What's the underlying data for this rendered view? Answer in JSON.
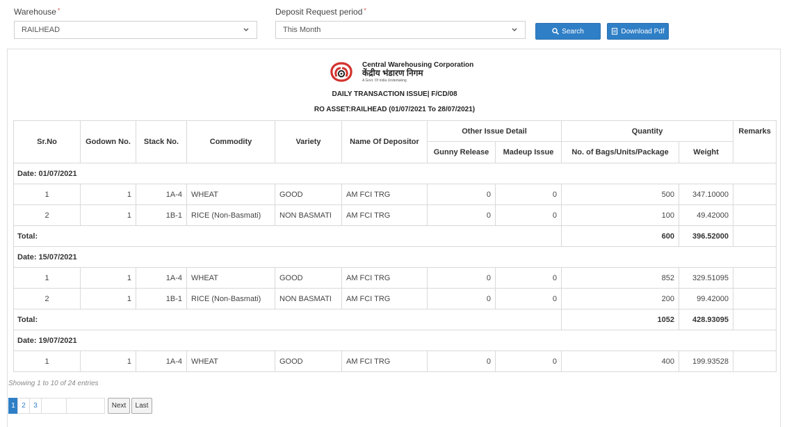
{
  "filters": {
    "warehouse_label": "Warehouse",
    "warehouse_value": "RAILHEAD",
    "period_label": "Deposit Request period",
    "period_value": "This Month",
    "required_mark": "*",
    "search_label": "Search",
    "download_label": "Download Pdf"
  },
  "header": {
    "org_name": "Central Warehousing Corporation",
    "org_hindi": "केंद्रीय भंडारण निगम",
    "org_sub": "A Govt. Of India Undertaking",
    "report_title": "DAILY TRANSACTION ISSUE| F/CD/08",
    "report_subtitle": "RO ASSET:RAILHEAD (01/07/2021 To 28/07/2021)"
  },
  "columns": {
    "srno": "Sr.No",
    "godown": "Godown No.",
    "stack": "Stack No.",
    "commodity": "Commodity",
    "variety": "Variety",
    "depositor": "Name Of Depositor",
    "other_issue": "Other Issue Detail",
    "gunny": "Gunny Release",
    "madeup": "Madeup Issue",
    "quantity": "Quantity",
    "bags": "No. of Bags/Units/Package",
    "weight": "Weight",
    "remarks": "Remarks"
  },
  "groups": [
    {
      "date_label": "Date: 01/07/2021",
      "rows": [
        {
          "sr": "1",
          "godown": "1",
          "stack": "1A-4",
          "commodity": "WHEAT",
          "variety": "GOOD",
          "depositor": "AM FCI TRG",
          "gunny": "0",
          "madeup": "0",
          "bags": "500",
          "weight": "347.10000",
          "remarks": ""
        },
        {
          "sr": "2",
          "godown": "1",
          "stack": "1B-1",
          "commodity": "RICE (Non-Basmati)",
          "variety": "NON BASMATI",
          "depositor": "AM FCI TRG",
          "gunny": "0",
          "madeup": "0",
          "bags": "100",
          "weight": "49.42000",
          "remarks": ""
        }
      ],
      "total_label": "Total:",
      "total_bags": "600",
      "total_weight": "396.52000"
    },
    {
      "date_label": "Date: 15/07/2021",
      "rows": [
        {
          "sr": "1",
          "godown": "1",
          "stack": "1A-4",
          "commodity": "WHEAT",
          "variety": "GOOD",
          "depositor": "AM FCI TRG",
          "gunny": "0",
          "madeup": "0",
          "bags": "852",
          "weight": "329.51095",
          "remarks": ""
        },
        {
          "sr": "2",
          "godown": "1",
          "stack": "1B-1",
          "commodity": "RICE (Non-Basmati)",
          "variety": "NON BASMATI",
          "depositor": "AM FCI TRG",
          "gunny": "0",
          "madeup": "0",
          "bags": "200",
          "weight": "99.42000",
          "remarks": ""
        }
      ],
      "total_label": "Total:",
      "total_bags": "1052",
      "total_weight": "428.93095"
    },
    {
      "date_label": "Date: 19/07/2021",
      "rows": [
        {
          "sr": "1",
          "godown": "1",
          "stack": "1A-4",
          "commodity": "WHEAT",
          "variety": "GOOD",
          "depositor": "AM FCI TRG",
          "gunny": "0",
          "madeup": "0",
          "bags": "400",
          "weight": "199.93528",
          "remarks": ""
        }
      ]
    }
  ],
  "footer": {
    "info": "Showing 1 to 10 of 24 entries",
    "pages": [
      "1",
      "2",
      "3",
      "",
      ""
    ],
    "active_page": "1",
    "next_label": "Next",
    "last_label": "Last"
  },
  "colors": {
    "accent": "#2f7fc6",
    "logo_red": "#d2322d",
    "required": "#d9534f"
  },
  "icons": [
    "search-icon",
    "pdf-icon",
    "chevron-down-icon",
    "cwc-logo"
  ]
}
